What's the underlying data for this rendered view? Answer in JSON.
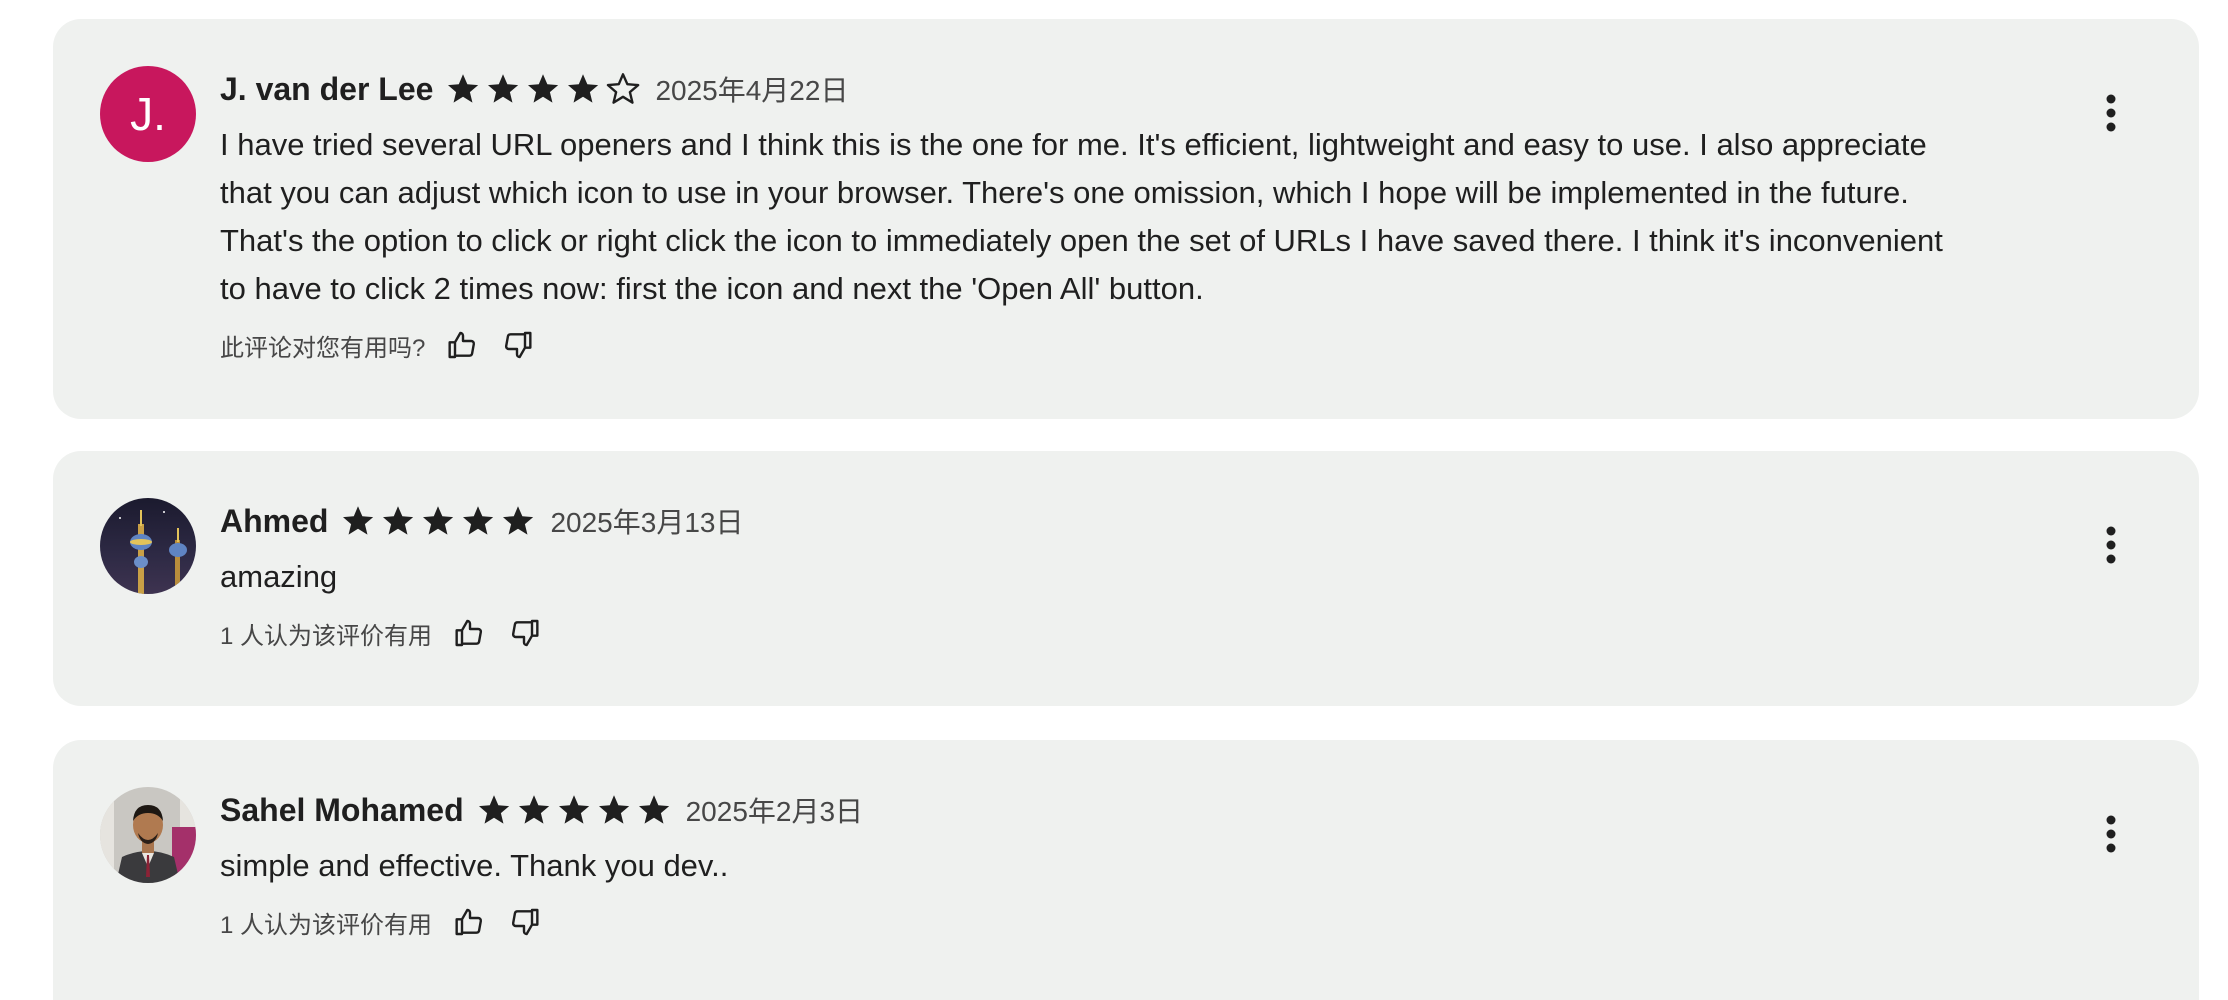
{
  "reviews": [
    {
      "author": "J. van der Lee",
      "avatar_type": "letter",
      "avatar_letter": "J.",
      "avatar_color": "#c8175d",
      "rating": 4,
      "max_rating": 5,
      "date": "2025年4月22日",
      "text_lines": [
        "I have tried several URL openers and I think this is the one for me. It's efficient, lightweight and easy to use. I also appreciate",
        "that you can adjust which icon to use in your browser. There's one omission, which I hope will be implemented in the future.",
        "That's the option to click or right click the icon to immediately open the set of URLs I have saved there. I think it's inconvenient",
        "to have to click 2 times now: first the icon and next the 'Open All' button."
      ],
      "helpful_label": "此评论对您有用吗?"
    },
    {
      "author": "Ahmed",
      "avatar_type": "photo-towers",
      "rating": 5,
      "max_rating": 5,
      "date": "2025年3月13日",
      "text_lines": [
        "amazing"
      ],
      "helpful_label": "1 人认为该评价有用"
    },
    {
      "author": "Sahel Mohamed",
      "avatar_type": "photo-person",
      "rating": 5,
      "max_rating": 5,
      "date": "2025年2月3日",
      "text_lines": [
        "simple and effective. Thank you dev.."
      ],
      "helpful_label": "1 人认为该评价有用"
    }
  ],
  "icons": {
    "star_filled": "star-filled-icon",
    "star_empty": "star-outline-icon",
    "thumb_up": "thumb-up-icon",
    "thumb_down": "thumb-down-icon",
    "more": "more-vert-icon"
  },
  "colors": {
    "card_background": "#eff1ef",
    "star": "#1f1f1f",
    "text_primary": "#1f1f1f",
    "text_secondary": "#474747"
  }
}
